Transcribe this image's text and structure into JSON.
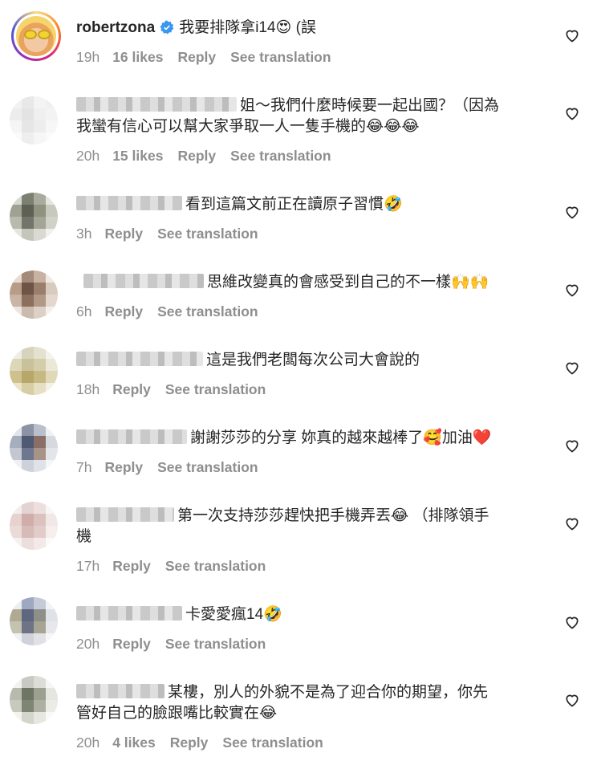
{
  "comments": [
    {
      "username": "robertzona",
      "verified": true,
      "text": "我要排隊拿i14😍 (誤",
      "time": "19h",
      "likes": "16 likes",
      "reply": "Reply",
      "translate": "See translation"
    },
    {
      "text_line1": "姐～我們什麼時候要一起出國？（因為",
      "text_line2": "我蠻有信心可以幫大家爭取一人一隻手機的😂😂😂",
      "time": "20h",
      "likes": "15 likes",
      "reply": "Reply",
      "translate": "See translation"
    },
    {
      "text": "看到這篇文前正在讀原子習慣🤣",
      "time": "3h",
      "reply": "Reply",
      "translate": "See translation"
    },
    {
      "text": "思維改變真的會感受到自己的不一樣🙌🙌",
      "time": "6h",
      "reply": "Reply",
      "translate": "See translation"
    },
    {
      "text": "這是我們老闆每次公司大會說的",
      "time": "18h",
      "reply": "Reply",
      "translate": "See translation"
    },
    {
      "text": "謝謝莎莎的分享 妳真的越來越棒了🥰加油❤️",
      "time": "7h",
      "reply": "Reply",
      "translate": "See translation"
    },
    {
      "text_line1": "第一次支持莎莎趕快把手機弄丟😂 （排隊領手",
      "text_line2": "機",
      "time": "17h",
      "reply": "Reply",
      "translate": "See translation"
    },
    {
      "text": "卡愛愛瘋14🤣",
      "time": "20h",
      "reply": "Reply",
      "translate": "See translation"
    },
    {
      "text_line1": "某樓，別人的外貌不是為了迎合你的期望，你先",
      "text_line2": "管好自己的臉跟嘴比較實在😂",
      "time": "20h",
      "likes": "4 likes",
      "reply": "Reply",
      "translate": "See translation"
    }
  ],
  "colors": {
    "text": "#262626",
    "meta": "#8e8e8e",
    "verified": "#3897f0"
  },
  "icons": {
    "like": "heart-outline-icon",
    "verified": "verified-badge-icon"
  }
}
